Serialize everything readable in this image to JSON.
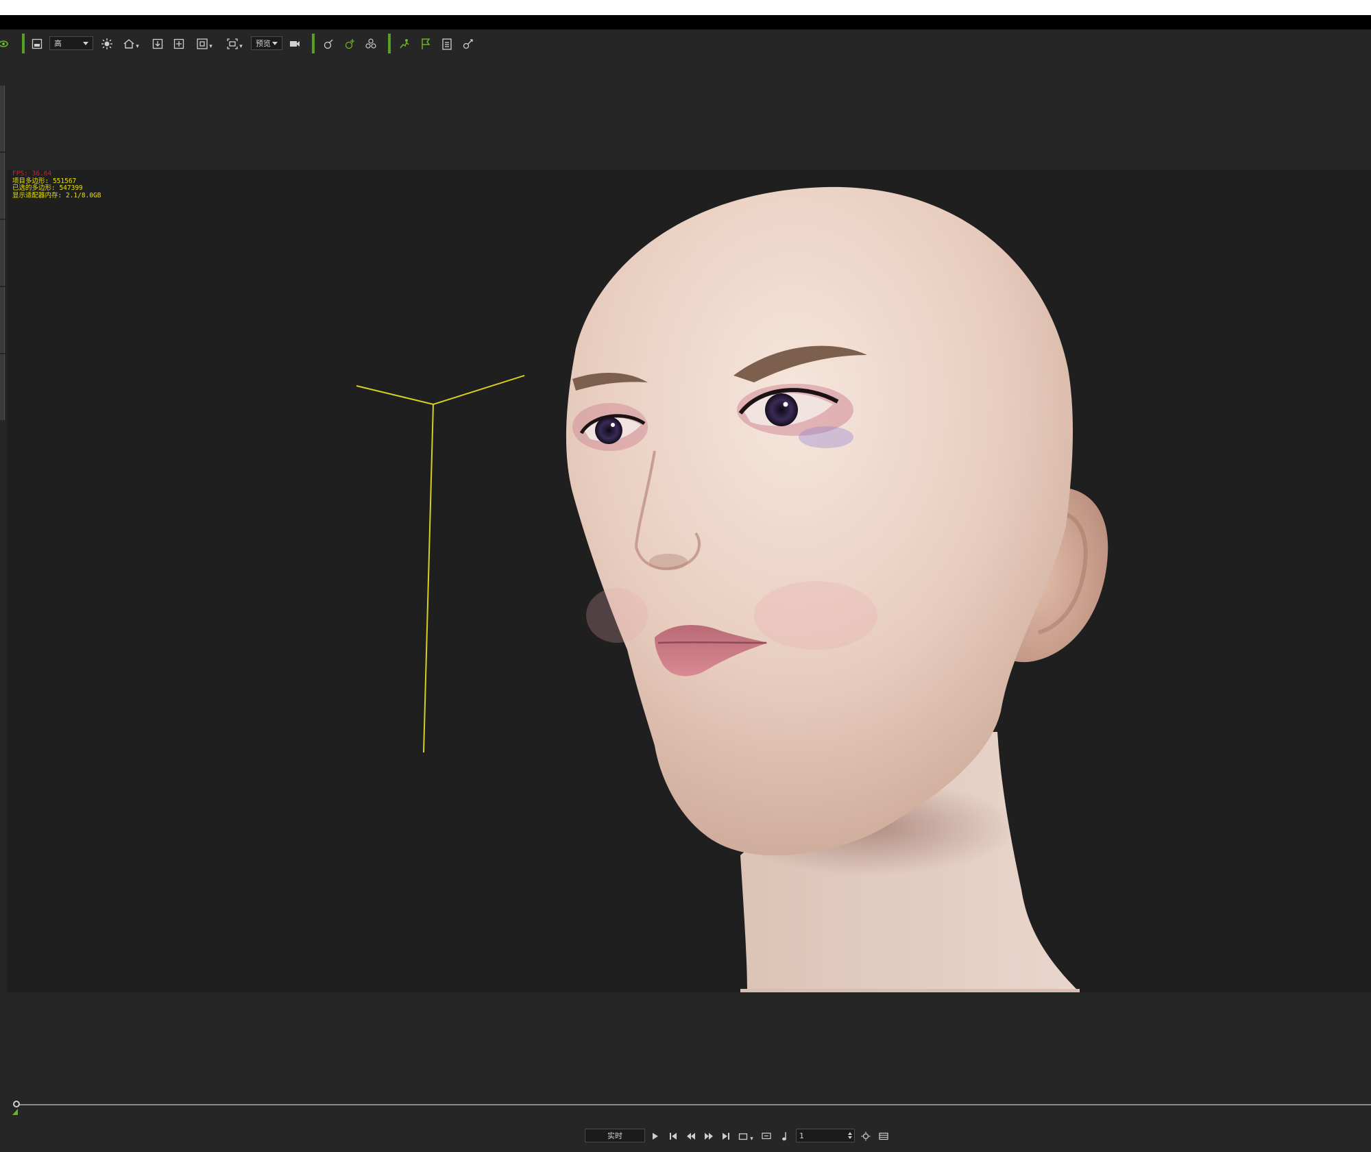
{
  "toolbar": {
    "quality_select_value": "高",
    "preview_select_value": "预览",
    "icons": [
      "eye-icon",
      "screen-icon",
      "sun-icon",
      "home-icon",
      "align-bottom-icon",
      "move-icon",
      "frame-icon",
      "camera-view-icon",
      "video-camera-icon",
      "gizmo-icon",
      "gizmo-plus-icon",
      "group-icon",
      "run-icon",
      "flag-icon",
      "checklist-icon",
      "link-icon"
    ]
  },
  "viewport": {
    "stats": {
      "fps": "FPS: 36.64",
      "project_polygons": "项目多边形: 551567",
      "selected_polygons": "已选的多边形: 547399",
      "display_memory": "显示适配器内存: 2.1/8.0GB"
    }
  },
  "playback": {
    "mode_value": "实时",
    "frame_value": "1",
    "icons": [
      "play-icon",
      "go-to-start-icon",
      "previous-frame-icon",
      "next-frame-icon",
      "go-to-end-icon",
      "loop-icon",
      "subtitle-icon",
      "music-note-icon",
      "settings-icon",
      "timeline-panel-icon"
    ]
  },
  "colors": {
    "accent_green": "#6cb42c",
    "stats_red": "#d62020",
    "stats_yellow": "#e8e000",
    "background": "#262626",
    "viewport": "#1f1f1f"
  }
}
